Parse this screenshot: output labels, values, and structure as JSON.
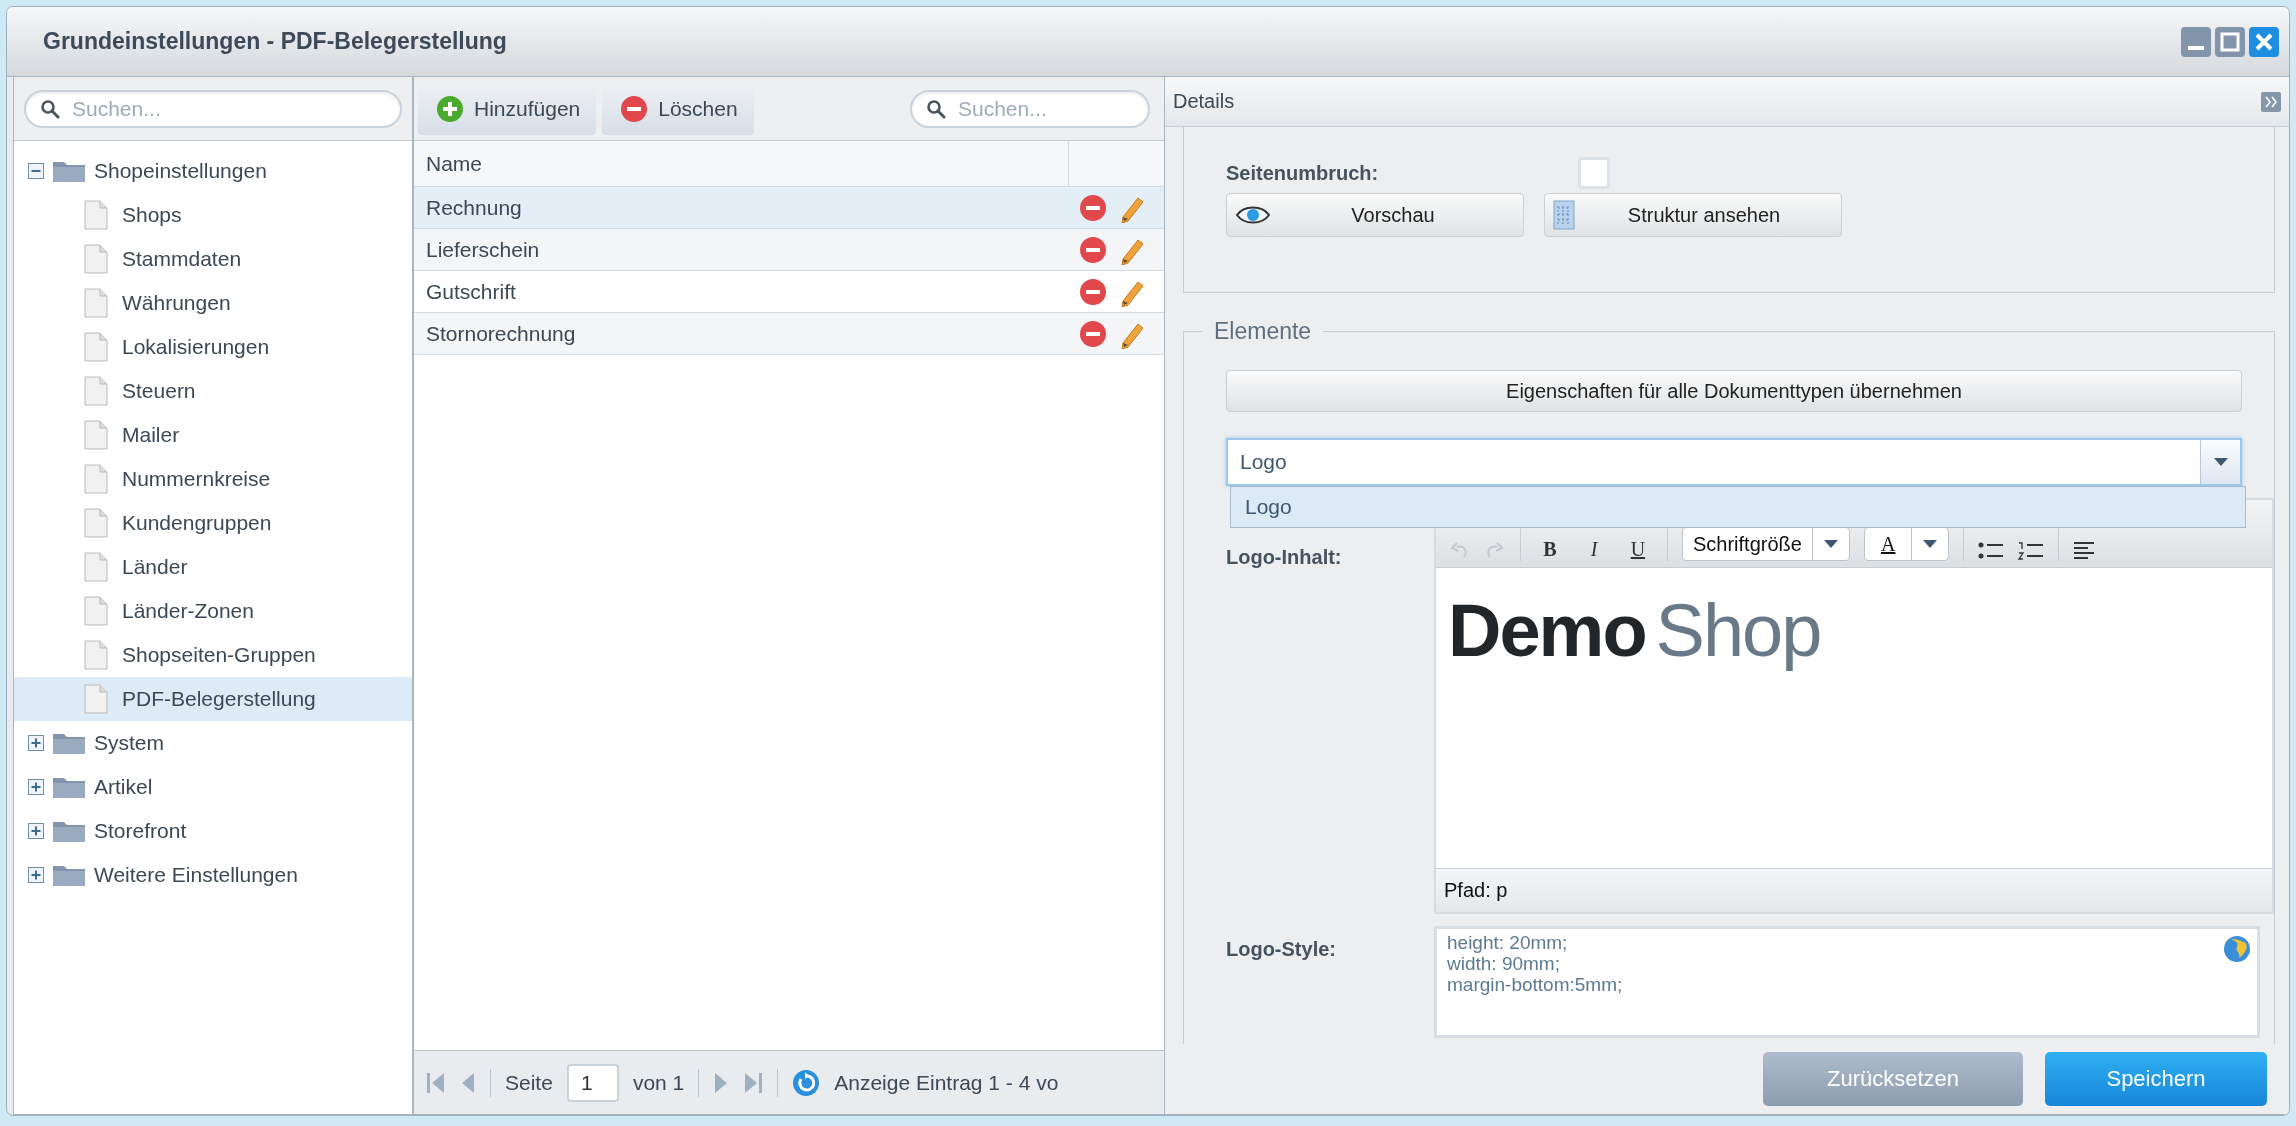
{
  "window": {
    "title": "Grundeinstellungen - PDF-Belegerstellung"
  },
  "tree": {
    "search": {
      "placeholder": "Suchen..."
    },
    "items": [
      {
        "label": "Shopeinstellungen",
        "expanded": true,
        "selected": false,
        "children": [
          {
            "label": "Shops",
            "selected": false
          },
          {
            "label": "Stammdaten",
            "selected": false
          },
          {
            "label": "Währungen",
            "selected": false
          },
          {
            "label": "Lokalisierungen",
            "selected": false
          },
          {
            "label": "Steuern",
            "selected": false
          },
          {
            "label": "Mailer",
            "selected": false
          },
          {
            "label": "Nummernkreise",
            "selected": false
          },
          {
            "label": "Kundengruppen",
            "selected": false
          },
          {
            "label": "Länder",
            "selected": false
          },
          {
            "label": "Länder-Zonen",
            "selected": false
          },
          {
            "label": "Shopseiten-Gruppen",
            "selected": false
          },
          {
            "label": "PDF-Belegerstellung",
            "selected": true
          }
        ]
      },
      {
        "label": "System",
        "expanded": false,
        "selected": false
      },
      {
        "label": "Artikel",
        "expanded": false,
        "selected": false
      },
      {
        "label": "Storefront",
        "expanded": false,
        "selected": false
      },
      {
        "label": "Weitere Einstellungen",
        "expanded": false,
        "selected": false
      }
    ]
  },
  "list": {
    "toolbar": [
      {
        "kind": "add",
        "label": "Hinzufügen"
      },
      {
        "kind": "delete",
        "label": "Löschen"
      }
    ],
    "search": {
      "placeholder": "Suchen..."
    },
    "columns": [
      "Name"
    ],
    "rows": [
      {
        "name": "Rechnung",
        "selected": true
      },
      {
        "name": "Lieferschein",
        "selected": false
      },
      {
        "name": "Gutschrift",
        "selected": false
      },
      {
        "name": "Stornorechnung",
        "selected": false
      }
    ],
    "pager": {
      "page_label": "Seite",
      "page": "1",
      "of": "von 1",
      "info": "Anzeige Eintrag 1 - 4 vo"
    }
  },
  "details": {
    "title": "Details",
    "page_break": {
      "label": "Seitenumbruch:",
      "checked": false
    },
    "buttons": [
      {
        "kind": "preview",
        "label": "Vorschau"
      },
      {
        "kind": "structure",
        "label": "Struktur ansehen"
      }
    ],
    "elements": {
      "legend": "Elemente",
      "apply_button": "Eigenschaften für alle Dokumenttypen übernehmen",
      "combo": {
        "value": "Logo",
        "options": [
          {
            "label": "Logo",
            "selected": true
          }
        ]
      },
      "content_label": "Logo-Inhalt:",
      "editor": {
        "format_buttons": [
          "B",
          "I",
          "U"
        ],
        "font_size": "Schriftgröße",
        "color_button": "A",
        "logo": [
          "Demo",
          "Shop"
        ],
        "path": "Pfad: p"
      },
      "style_label": "Logo-Style:",
      "style_lines": [
        "height: 20mm;",
        "width: 90mm;",
        "margin-bottom:5mm;"
      ]
    },
    "footer": [
      {
        "kind": "reset",
        "label": "Zurücksetzen"
      },
      {
        "kind": "save",
        "label": "Speichern"
      }
    ]
  }
}
